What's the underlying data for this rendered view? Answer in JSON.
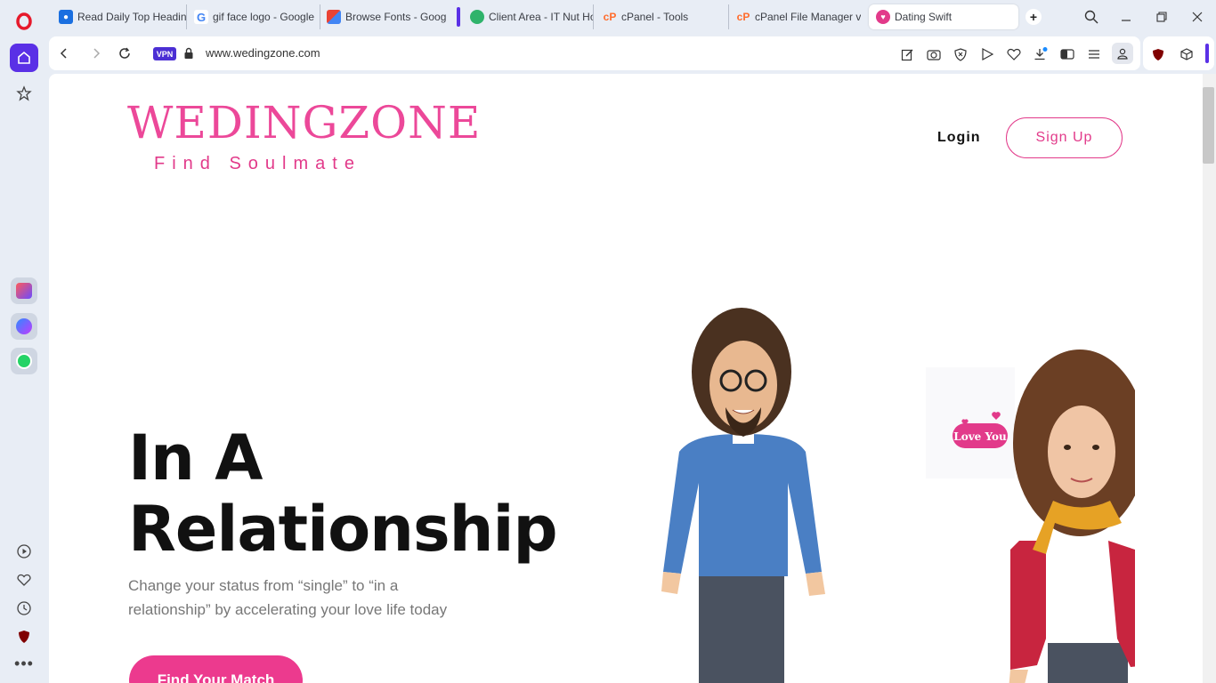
{
  "browser": {
    "tabs": [
      {
        "title": "Read Daily Top Headin",
        "icon_color": "#1a6fe0"
      },
      {
        "title": "gif face logo - Google",
        "icon_color": "#4285f4"
      },
      {
        "title": "Browse Fonts - Google",
        "icon_color": "#34a853"
      },
      {
        "title": "Client Area - IT Nut Ho",
        "icon_color": "#2fb36b"
      },
      {
        "title": "cPanel - Tools",
        "icon_color": "#ff6c2c"
      },
      {
        "title": "cPanel File Manager v",
        "icon_color": "#ff6c2c"
      },
      {
        "title": "Dating Swift",
        "icon_color": "#e23a8a"
      }
    ],
    "new_tab_label": "+",
    "vpn_label": "VPN",
    "url": "www.wedingzone.com",
    "accent": "#5a30e6"
  },
  "site": {
    "logo_title": "WEDINGZONE",
    "logo_tagline": "Find Soulmate",
    "nav": {
      "login": "Login",
      "signup": "Sign Up"
    },
    "hero": {
      "title_line1": "In A",
      "title_line2": "Relationship",
      "subtitle": "Change your status from “single” to “in a relationship” by accelerating your love life today",
      "cta": "Find Your Match"
    },
    "illustration": {
      "sticker_text": "Love You"
    },
    "brand_color": "#ec3a8e"
  }
}
